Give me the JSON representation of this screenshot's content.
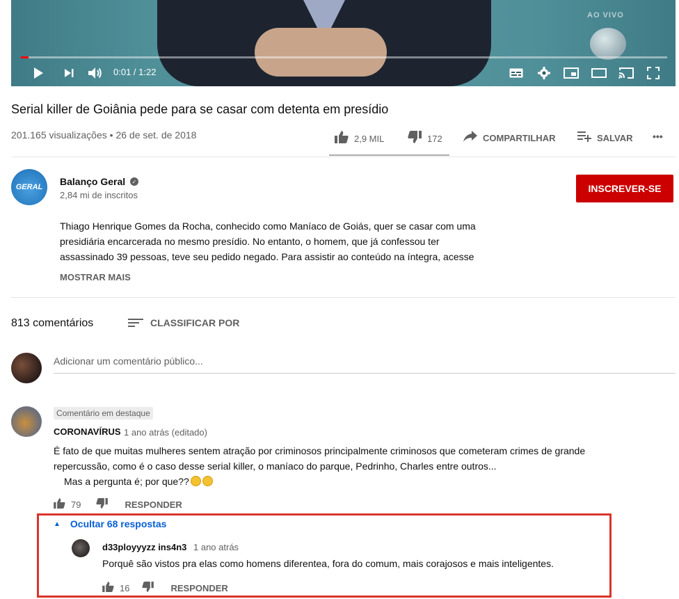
{
  "player": {
    "live_badge": "AO VIVO",
    "time": "0:01 / 1:22",
    "progress": 0.012,
    "accent": "#ff0000"
  },
  "video": {
    "title": "Serial killer de Goiânia pede para se casar com detenta em presídio",
    "views": "201.165 visualizações",
    "date": "26 de set. de 2018",
    "likes": "2,9 MIL",
    "dislikes": "172",
    "share": "COMPARTILHAR",
    "save": "SALVAR",
    "more": "•••"
  },
  "channel": {
    "name": "Balanço Geral",
    "subscribers": "2,84 mi de inscritos",
    "subscribe": "INSCREVER-SE",
    "logo_text": "GERAL",
    "subscribe_color": "#cc0000"
  },
  "description": {
    "line1": "Thiago Henrique Gomes da Rocha, conhecido como Maníaco de Goiás, quer se casar com uma",
    "line2": "presidiária encarcerada no mesmo presídio. No entanto, o homem, que já confessou ter",
    "line3": "assassinado 39 pessoas, teve seu pedido negado. Para assistir ao conteúdo na íntegra, acesse",
    "show_more": "MOSTRAR MAIS"
  },
  "comments": {
    "count": "813 comentários",
    "sort": "CLASSIFICAR POR",
    "placeholder": "Adicionar um comentário público...",
    "pinned": {
      "badge": "Comentário em destaque",
      "author": "CORONAVÍRUS",
      "time": "1 ano atrás (editado)",
      "line1": "É fato de que muitas mulheres sentem atração por criminosos principalmente criminosos que cometeram crimes de grande",
      "line2": "repercussão, como é o caso desse serial killer, o maníaco do parque, Pedrinho, Charles entre outros...",
      "line3": "Mas a pergunta é; por que??",
      "likes": "79",
      "reply": "RESPONDER",
      "hide_replies": "Ocultar 68 respostas"
    },
    "reply1": {
      "author": "d33ployyyzz ins4n3",
      "time": "1 ano atrás",
      "text": "Porquê são vistos pra elas como homens diferentea, fora do comum, mais corajosos e mais inteligentes.",
      "likes": "16",
      "reply": "RESPONDER"
    },
    "link_color": "#065fd4",
    "highlight_color": "#d9342b"
  }
}
